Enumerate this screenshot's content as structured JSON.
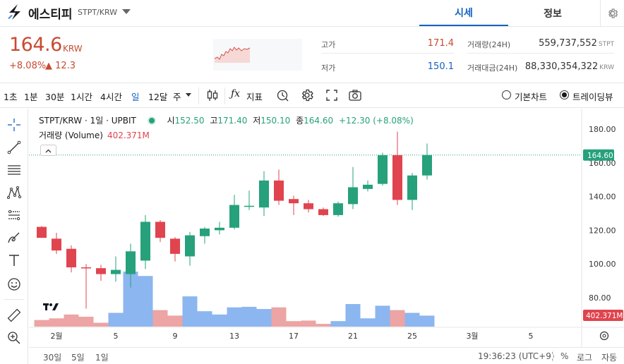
{
  "header": {
    "name": "에스티피",
    "pair": "STPT/KRW",
    "tabs": [
      "시세",
      "정보"
    ]
  },
  "price": {
    "current": "164.6",
    "unit": "KRW",
    "change_rate": "+8.08%",
    "change_amount": "▲ 12.3"
  },
  "stats": {
    "high_label": "고가",
    "high_value": "171.4",
    "low_label": "저가",
    "low_value": "150.1",
    "volume_label": "거래량(24H)",
    "volume_value": "559,737,552",
    "volume_unit": "STPT",
    "amount_label": "거래대금(24H)",
    "amount_value": "88,330,354,322",
    "amount_unit": "KRW"
  },
  "toolbar": {
    "intervals": [
      "1초",
      "1분",
      "30분",
      "1시간",
      "4시간",
      "일",
      "12달",
      "주"
    ],
    "selected_interval": "일",
    "indicator_label": "지표",
    "basic_chart_label": "기본차트",
    "tradingview_label": "트레이딩뷰",
    "selected_mode": "트레이딩뷰"
  },
  "legend": {
    "title": "STPT/KRW · 1일 · UPBIT",
    "open_label": "시",
    "open_value": "152.50",
    "high_label": "고",
    "high_value": "171.40",
    "low_label": "저",
    "low_value": "150.10",
    "close_label": "종",
    "close_value": "164.60",
    "change": "+12.30 (+8.08%)",
    "volume_label": "거래량 (Volume)",
    "volume_value": "402.371M"
  },
  "bottom": {
    "ranges": [
      "30일",
      "5일",
      "1일"
    ],
    "time": "19:36:23 (UTC+9)",
    "percent": "%",
    "log": "로그",
    "auto": "자동"
  },
  "colors": {
    "up": "#26a17b",
    "down": "#e0444e",
    "accent": "#1261c4",
    "price_red": "#c84a31",
    "vol_up": "#eda4a4",
    "vol_down": "#8cb6ef"
  },
  "chart_data": {
    "type": "candlestick",
    "y_axis_labels": [
      "180.00",
      "160.00",
      "140.00",
      "120.00",
      "100.00",
      "80.00"
    ],
    "ylim": [
      70,
      185
    ],
    "x_tick_labels": [
      "2월",
      "5",
      "9",
      "13",
      "17",
      "21",
      "25",
      "3월",
      "5"
    ],
    "current_price_label": "164.60",
    "current_volume_label": "402.371M",
    "candles": [
      {
        "o": 122.0,
        "h": 122.5,
        "l": 116.0,
        "c": 115.5
      },
      {
        "o": 115.0,
        "h": 118.5,
        "l": 106.0,
        "c": 108.0
      },
      {
        "o": 109.0,
        "h": 111.0,
        "l": 95.0,
        "c": 98.0
      },
      {
        "o": 98.0,
        "h": 100.0,
        "l": 73.5,
        "c": 97.5
      },
      {
        "o": 97.5,
        "h": 99.5,
        "l": 90.0,
        "c": 94.0
      },
      {
        "o": 94.0,
        "h": 104.5,
        "l": 89.5,
        "c": 96.5
      },
      {
        "o": 94.0,
        "h": 112.0,
        "l": 86.0,
        "c": 107.5
      },
      {
        "o": 102.0,
        "h": 129.0,
        "l": 97.0,
        "c": 125.0
      },
      {
        "o": 125.0,
        "h": 126.0,
        "l": 113.0,
        "c": 115.5
      },
      {
        "o": 115.0,
        "h": 116.0,
        "l": 101.5,
        "c": 106.0
      },
      {
        "o": 104.5,
        "h": 119.0,
        "l": 99.0,
        "c": 117.0
      },
      {
        "o": 116.5,
        "h": 122.0,
        "l": 112.0,
        "c": 121.0
      },
      {
        "o": 120.0,
        "h": 125.0,
        "l": 117.5,
        "c": 121.5
      },
      {
        "o": 121.5,
        "h": 141.0,
        "l": 120.5,
        "c": 135.0
      },
      {
        "o": 134.0,
        "h": 143.5,
        "l": 132.0,
        "c": 134.5
      },
      {
        "o": 133.5,
        "h": 155.0,
        "l": 128.5,
        "c": 149.5
      },
      {
        "o": 149.5,
        "h": 156.0,
        "l": 135.0,
        "c": 137.5
      },
      {
        "o": 138.5,
        "h": 140.5,
        "l": 129.0,
        "c": 136.0
      },
      {
        "o": 136.0,
        "h": 138.0,
        "l": 130.5,
        "c": 132.5
      },
      {
        "o": 132.5,
        "h": 133.5,
        "l": 128.5,
        "c": 129.0
      },
      {
        "o": 129.0,
        "h": 137.0,
        "l": 128.0,
        "c": 136.0
      },
      {
        "o": 135.5,
        "h": 157.5,
        "l": 132.5,
        "c": 145.5
      },
      {
        "o": 144.5,
        "h": 149.5,
        "l": 143.0,
        "c": 147.0
      },
      {
        "o": 147.5,
        "h": 166.0,
        "l": 146.5,
        "c": 164.5
      },
      {
        "o": 164.5,
        "h": 178.5,
        "l": 135.0,
        "c": 138.0
      },
      {
        "o": 138.0,
        "h": 154.0,
        "l": 132.0,
        "c": 152.5
      },
      {
        "o": 152.5,
        "h": 171.4,
        "l": 150.1,
        "c": 164.6
      }
    ],
    "volume_relative": [
      0.12,
      0.15,
      0.22,
      0.18,
      0.07,
      0.25,
      1.0,
      0.92,
      0.3,
      0.2,
      0.55,
      0.28,
      0.22,
      0.35,
      0.36,
      0.32,
      0.35,
      0.1,
      0.11,
      0.05,
      0.1,
      0.41,
      0.15,
      0.38,
      0.3,
      0.25,
      0.2
    ]
  }
}
